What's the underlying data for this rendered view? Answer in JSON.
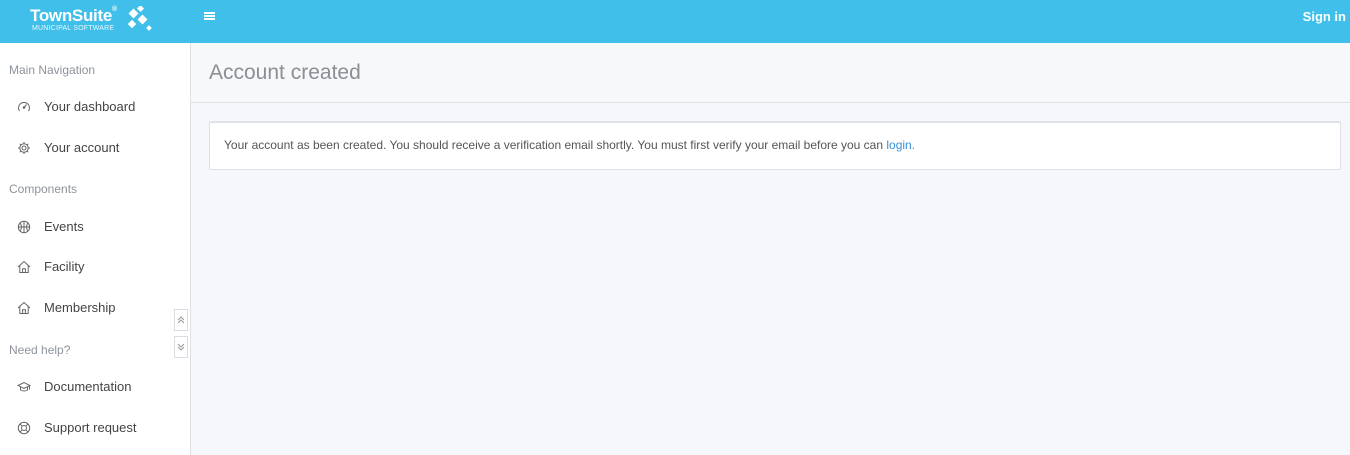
{
  "header": {
    "logo_name": "TownSuite",
    "logo_reg": "®",
    "logo_sub": "MUNICIPAL SOFTWARE",
    "signin_label": "Sign in"
  },
  "sidebar": {
    "sections": [
      {
        "label": "Main Navigation",
        "items": [
          {
            "label": "Your dashboard",
            "icon": "dashboard-icon"
          },
          {
            "label": "Your account",
            "icon": "gear-icon"
          }
        ]
      },
      {
        "label": "Components",
        "items": [
          {
            "label": "Events",
            "icon": "basketball-icon"
          },
          {
            "label": "Facility",
            "icon": "home-icon"
          },
          {
            "label": "Membership",
            "icon": "home-icon"
          }
        ]
      },
      {
        "label": "Need help?",
        "items": [
          {
            "label": "Documentation",
            "icon": "graduation-cap-icon"
          },
          {
            "label": "Support request",
            "icon": "lifebuoy-icon"
          }
        ]
      }
    ]
  },
  "main": {
    "page_title": "Account created",
    "alert_text": "Your account as been created. You should receive a verification email shortly. You must first verify your email before you can ",
    "alert_link": "login.",
    "colors": {
      "topbar": "#3fbfe9",
      "link": "#3a8fd6"
    }
  }
}
